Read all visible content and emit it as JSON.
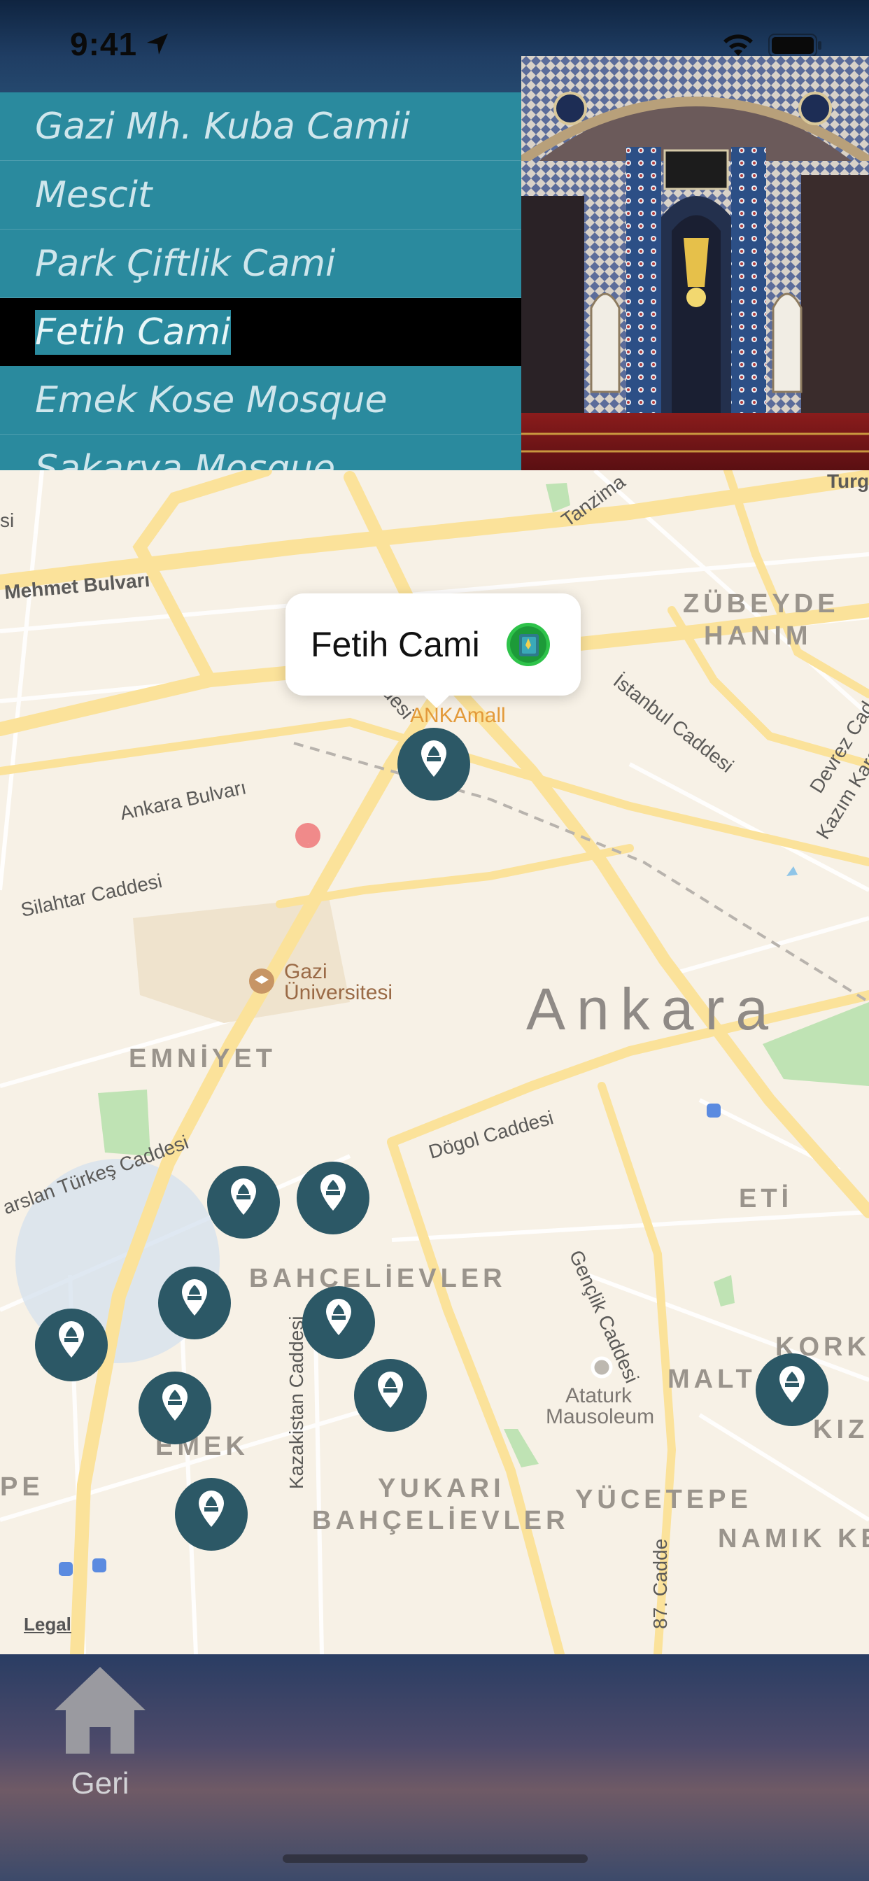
{
  "status_bar": {
    "time": "9:41"
  },
  "mosque_list": {
    "items": [
      {
        "label": "Gazi Mh. Kuba Camii",
        "selected": false
      },
      {
        "label": "Mescit",
        "selected": false
      },
      {
        "label": "Park Çiftlik Cami",
        "selected": false
      },
      {
        "label": "Fetih Cami",
        "selected": true
      },
      {
        "label": "Emek Kose Mosque",
        "selected": false
      },
      {
        "label": "Sakarya Mosque",
        "selected": false
      }
    ]
  },
  "map": {
    "callout": {
      "title": "Fetih Cami",
      "info_icon": "info-book-icon"
    },
    "labels": {
      "city": "Ankara",
      "zubeyde_1": "ZÜBEYDE",
      "zubeyde_2": "HANIM",
      "emniyet": "EMNİYET",
      "bahcelievler": "BAHÇELİEVLER",
      "emek": "EMEK",
      "yukari_1": "YUKARI",
      "yukari_2": "BAHÇELİEVLER",
      "yucetepe": "YÜCETEPE",
      "namik": "NAMIK KE",
      "eti": "ETİ",
      "malt": "MALT",
      "kork": "KORK",
      "kiz": "KIZ",
      "pe": "PE",
      "mehmet": "Mehmet Bulvarı",
      "ankara_bulvari": "Ankara Bulvarı",
      "silahtar": "Silahtar Caddesi",
      "dogol": "Dögol Caddesi",
      "genclik": "Gençlik Caddesi",
      "istanbul": "İstanbul Caddesi",
      "devrez": "Devrez Cad",
      "kazim": "Kazım Karab",
      "tanzimat": "Tanzima",
      "turg": "Turg",
      "kazakistan": "Kazakistan Caddesi",
      "alparslan": "arslan Türkeş Caddesi",
      "cadde87": "87. Cadde",
      "im_caddesi": "im Caddesi",
      "ankamall": "ANKAmall",
      "gazi_1": "Gazi",
      "gazi_2": "Üniversitesi",
      "ataturk_1": "Ataturk",
      "ataturk_2": "Mausoleum",
      "si": "si"
    },
    "legal": "Legal",
    "pin_icon": "mosque-pin-icon",
    "pin_color": "#2c5866"
  },
  "bottom_bar": {
    "back_label": "Geri",
    "back_icon": "home-icon"
  }
}
